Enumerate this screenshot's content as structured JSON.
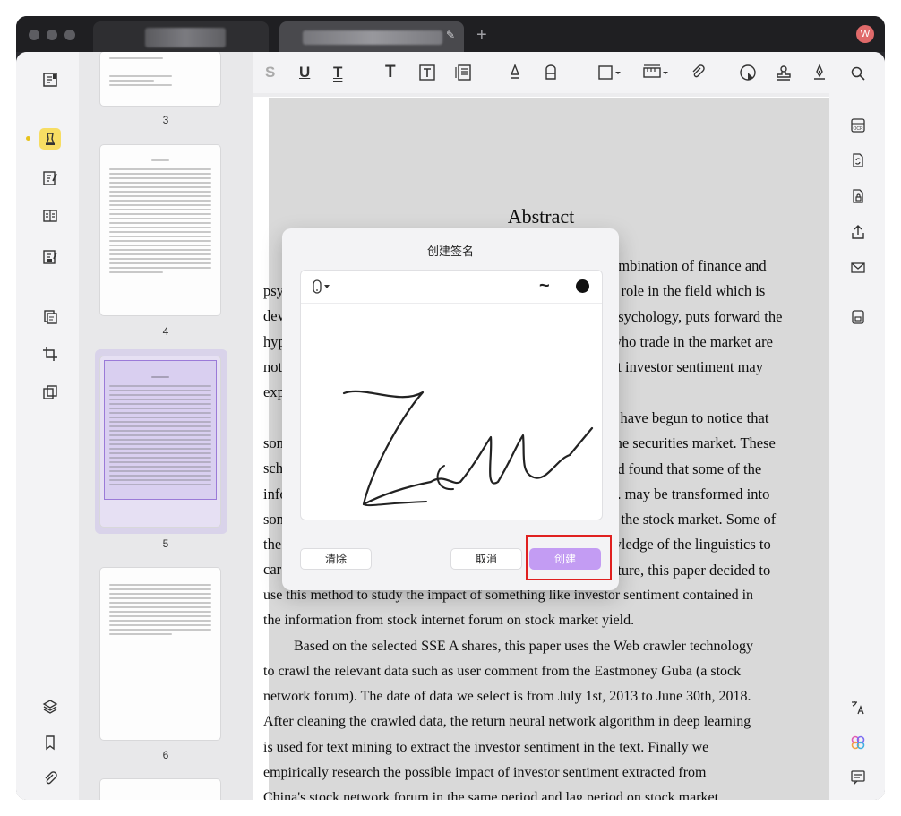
{
  "titlebar": {
    "avatar_initial": "W",
    "new_tab_symbol": "+"
  },
  "thumbnails": [
    {
      "page": "3"
    },
    {
      "page": "4"
    },
    {
      "page": "5"
    },
    {
      "page": "6"
    }
  ],
  "document": {
    "heading": "Abstract",
    "right_lines": [
      "ombination of finance and",
      "e role in the field which is",
      "psychology, puts forward the",
      "who trade in the market are",
      "at investor sentiment may"
    ],
    "left_fragments": [
      "psy",
      "dev",
      "hyp",
      "not",
      "exp"
    ],
    "mid_right_lines": [
      "s have begun to notice that",
      "the securities market. These",
      "ad found that some of the",
      "c. may be transformed into",
      "e the stock market. Some of",
      "wledge of the linguistics to",
      "ature, this paper decided to"
    ],
    "mid_left_fragments": [
      "son",
      "sch",
      "info",
      "son",
      "the",
      "car"
    ],
    "full_lines": [
      "use this method to study the impact of something like investor sentiment contained in",
      "the information from stock internet forum on stock market yield.",
      "Based on the selected SSE A shares, this paper uses the Web crawler technology",
      "to crawl the relevant data such as user comment from the Eastmoney Guba (a stock",
      "network forum). The date of data we select is from July 1st, 2013 to June 30th, 2018.",
      "After cleaning the crawled data, the return neural network algorithm in deep learning",
      "is used for text mining to extract the investor sentiment in the text. Finally we",
      "empirically research the possible impact of  investor sentiment extracted from",
      "China's stock network forum in the same period and lag period on stock market"
    ]
  },
  "dialog": {
    "title": "创建签名",
    "clear_label": "清除",
    "cancel_label": "取消",
    "create_label": "创建",
    "stroke_symbol": "~",
    "ink_color": "#111111",
    "primary_color": "#c39cf3"
  },
  "colors": {
    "highlight_box": "#e02020",
    "active_tool": "#f7dd63"
  }
}
